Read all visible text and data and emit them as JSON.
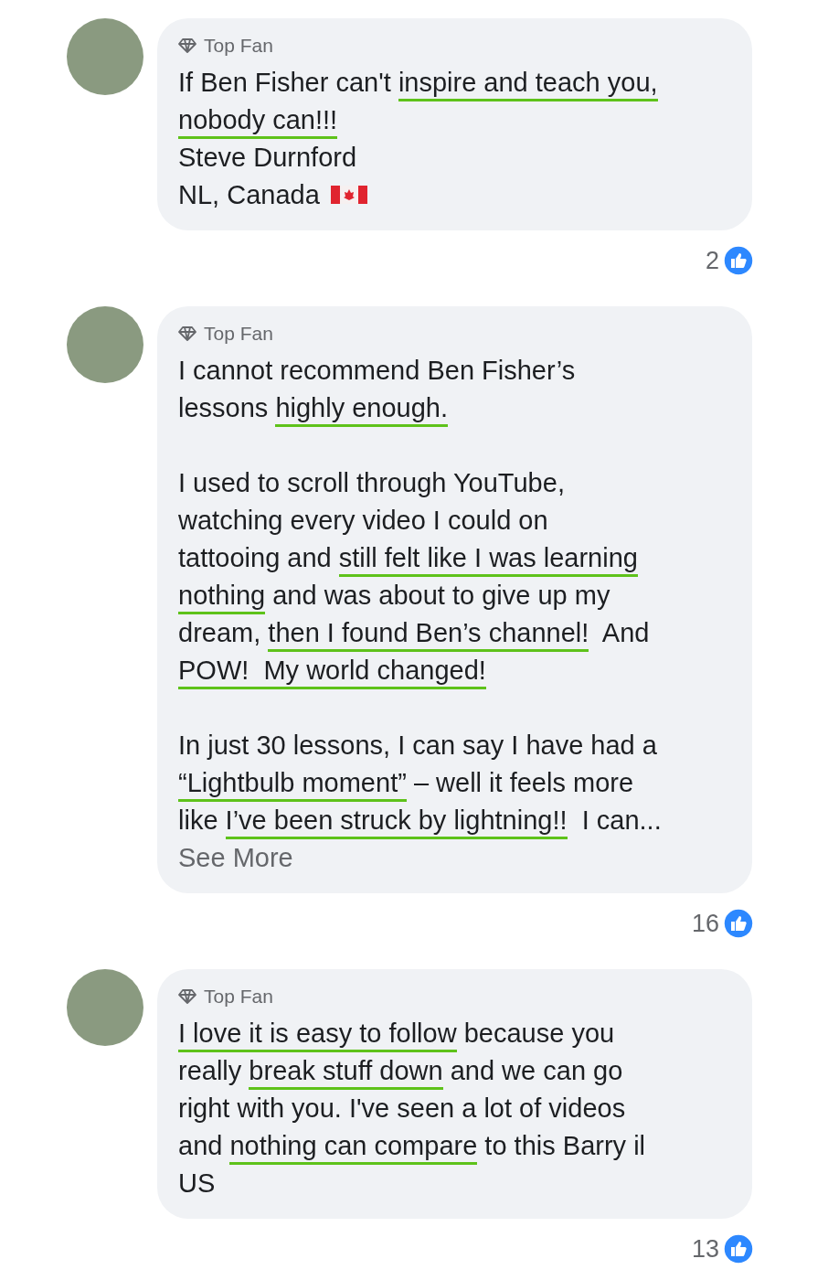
{
  "comments": [
    {
      "badge": "Top Fan",
      "paragraphs": [
        [
          {
            "segments": [
              {
                "text": "If Ben Fisher can't ",
                "underlined": false
              },
              {
                "text": "inspire and teach you,",
                "underlined": true
              }
            ]
          },
          {
            "segments": [
              {
                "text": "nobody can!!!",
                "underlined": true
              }
            ]
          },
          {
            "segments": [
              {
                "text": "Steve Durnford",
                "underlined": false
              }
            ]
          },
          {
            "segments": [
              {
                "text": "NL, Canada",
                "underlined": false
              }
            ],
            "flag": true
          }
        ]
      ],
      "likes": "2"
    },
    {
      "badge": "Top Fan",
      "paragraphs": [
        [
          {
            "segments": [
              {
                "text": "I cannot recommend Ben Fisher’s",
                "underlined": false
              }
            ]
          },
          {
            "segments": [
              {
                "text": "lessons ",
                "underlined": false
              },
              {
                "text": "highly enough.",
                "underlined": true
              }
            ]
          }
        ],
        [
          {
            "segments": [
              {
                "text": "I used to scroll through YouTube,",
                "underlined": false
              }
            ]
          },
          {
            "segments": [
              {
                "text": "watching every video I could on",
                "underlined": false
              }
            ]
          },
          {
            "segments": [
              {
                "text": "tattooing and ",
                "underlined": false
              },
              {
                "text": "still felt like I was learning",
                "underlined": true
              }
            ]
          },
          {
            "segments": [
              {
                "text": "nothing",
                "underlined": true
              },
              {
                "text": " and was about to give up my",
                "underlined": false
              }
            ]
          },
          {
            "segments": [
              {
                "text": "dream, ",
                "underlined": false
              },
              {
                "text": "then I found Ben’s channel!",
                "underlined": true
              },
              {
                "text": "  And",
                "underlined": false
              }
            ]
          },
          {
            "segments": [
              {
                "text": "POW!  My world changed!",
                "underlined": true
              }
            ]
          }
        ],
        [
          {
            "segments": [
              {
                "text": "In just 30 lessons, I can say I have had a",
                "underlined": false
              }
            ]
          },
          {
            "segments": [
              {
                "text": "“Lightbulb moment”",
                "underlined": true
              },
              {
                "text": " – well it feels more",
                "underlined": false
              }
            ]
          },
          {
            "segments": [
              {
                "text": "like ",
                "underlined": false
              },
              {
                "text": "I’ve been struck by lightning!!",
                "underlined": true
              },
              {
                "text": "  I can...",
                "underlined": false
              }
            ]
          }
        ]
      ],
      "see_more": "See More",
      "likes": "16"
    },
    {
      "badge": "Top Fan",
      "paragraphs": [
        [
          {
            "segments": [
              {
                "text": "I love it is easy to follow",
                "underlined": true
              },
              {
                "text": " because you",
                "underlined": false
              }
            ]
          },
          {
            "segments": [
              {
                "text": "really ",
                "underlined": false
              },
              {
                "text": "break stuff down",
                "underlined": true
              },
              {
                "text": " and we can go",
                "underlined": false
              }
            ]
          },
          {
            "segments": [
              {
                "text": "right with you. I've seen a lot of videos",
                "underlined": false
              }
            ]
          },
          {
            "segments": [
              {
                "text": "and ",
                "underlined": false
              },
              {
                "text": "nothing can compare",
                "underlined": true
              },
              {
                "text": " to this Barry il",
                "underlined": false
              }
            ]
          },
          {
            "segments": [
              {
                "text": "US",
                "underlined": false
              }
            ]
          }
        ]
      ],
      "likes": "13"
    }
  ]
}
